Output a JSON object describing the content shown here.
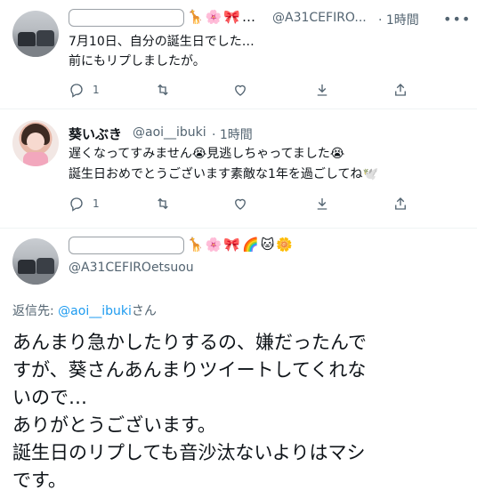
{
  "tweets": [
    {
      "emojis": "🦒🌸🎀…",
      "handle": "@A31CEFIRO...",
      "time": "· 1時間",
      "more": "•••",
      "lines": [
        "7月10日、自分の誕生日でした…",
        "前にもリプしましたが。"
      ],
      "reply_count": "1"
    },
    {
      "display_name": "葵いぶき",
      "handle": "@aoi__ibuki",
      "time": "· 1時間",
      "lines": [
        "遅くなってすみません😭見逃しちゃってました😭",
        "誕生日おめでとうございます素敵な1年を過ごしてね🕊️"
      ],
      "reply_count": "1"
    }
  ],
  "main_tweet": {
    "emojis": "🦒🌸🎀🌈🐱🌼",
    "handle": "@A31CEFIROetsuou",
    "reply_label": "返信先:",
    "reply_mention": "@aoi__ibuki",
    "reply_suffix": "さん",
    "lines": [
      "あんまり急かしたりするの、嫌だったんで",
      "すが、葵さんあんまりツイートしてくれな",
      "いので…",
      "ありがとうございます。",
      "誕生日のリプしても音沙汰ないよりはマシ",
      "です。"
    ]
  },
  "icons": [
    "reply-icon",
    "retweet-icon",
    "like-icon",
    "reply-icon",
    "retweet-icon",
    "like-icon",
    "download-icon",
    "share-icon"
  ],
  "colors": {
    "link": "#1d9bf0",
    "muted": "#536471",
    "text": "#0f1419",
    "divider": "#eff3f4"
  }
}
